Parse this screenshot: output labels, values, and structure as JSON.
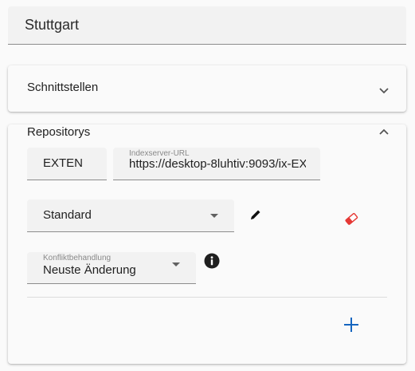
{
  "header": {
    "location_title": "Stuttgart"
  },
  "panels": {
    "schnittstellen": {
      "label": "Schnittstellen",
      "expanded": false,
      "icon": "chevron-down-icon"
    },
    "repositorys": {
      "label": "Repositorys",
      "expanded": true,
      "icon": "chevron-up-icon",
      "prefix_field": {
        "value": "EXTEN"
      },
      "url_field": {
        "label": "Indexserver-URL",
        "value": "https://desktop-8luhtiv:9093/ix-EX"
      },
      "type_select": {
        "value": "Standard"
      },
      "conflict_select": {
        "label": "Konfliktbehandlung",
        "value": "Neuste Änderung"
      },
      "icons": {
        "edit": "pencil-icon",
        "delete": "eraser-icon",
        "info": "info-icon",
        "add": "plus-icon"
      }
    }
  },
  "colors": {
    "accent": "#1565c0",
    "danger": "#e53935",
    "background": "#fafafa",
    "field": "#f2f2f2"
  }
}
